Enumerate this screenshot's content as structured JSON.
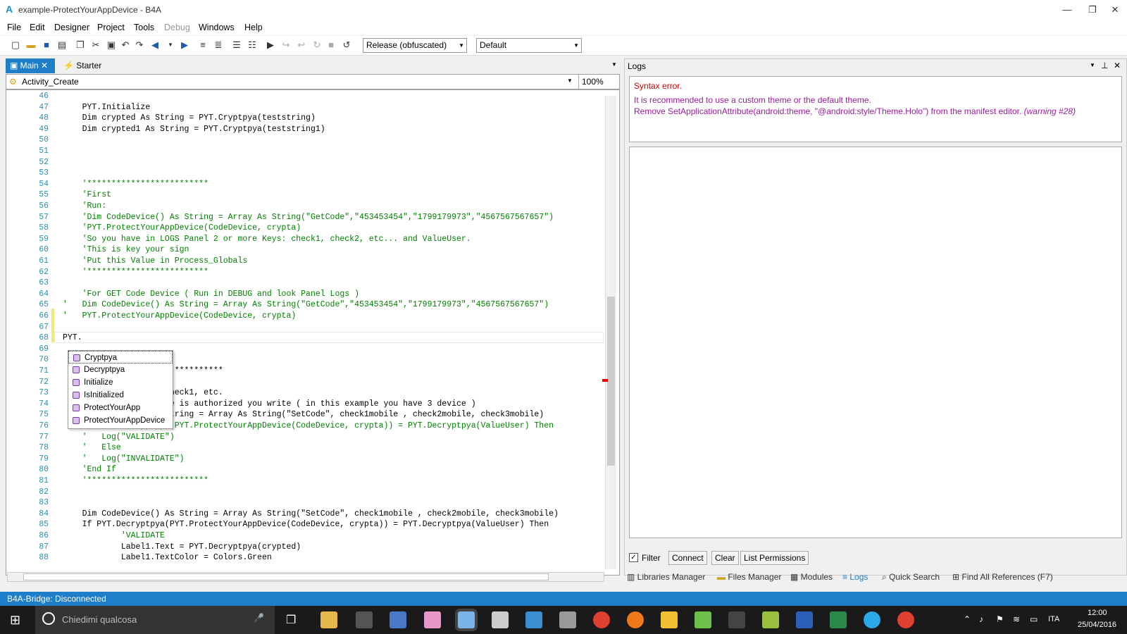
{
  "window": {
    "title": "example-ProtectYourAppDevice - B4A",
    "minimize_glyph": "—",
    "restore_glyph": "❐",
    "close_glyph": "✕"
  },
  "menu": [
    "File",
    "Edit",
    "Designer",
    "Project",
    "Tools",
    "Debug",
    "Windows",
    "Help"
  ],
  "toolbar": {
    "build_config": "Release (obfuscated)",
    "device": "Default"
  },
  "editor": {
    "tabs": [
      {
        "label": "Main",
        "active": true
      },
      {
        "label": "Starter",
        "active": false
      }
    ],
    "sub_selector": "Activity_Create",
    "zoom": "100%",
    "lines": [
      {
        "n": "46",
        "text": ""
      },
      {
        "n": "47",
        "text": "    PYT.Initialize"
      },
      {
        "n": "48",
        "text": "    Dim crypted As String = PYT.Cryptpya(teststring)"
      },
      {
        "n": "49",
        "text": "    Dim crypted1 As String = PYT.Cryptpya(teststring1)"
      },
      {
        "n": "50",
        "text": ""
      },
      {
        "n": "51",
        "text": ""
      },
      {
        "n": "52",
        "text": ""
      },
      {
        "n": "53",
        "text": ""
      },
      {
        "n": "54",
        "text": "    '*************************"
      },
      {
        "n": "55",
        "text": "    'First"
      },
      {
        "n": "56",
        "text": "    'Run:"
      },
      {
        "n": "57",
        "text": "    'Dim CodeDevice() As String = Array As String(\"GetCode\",\"453453454\",\"1799179973\",\"4567567567657\")"
      },
      {
        "n": "58",
        "text": "    'PYT.ProtectYourAppDevice(CodeDevice, crypta)"
      },
      {
        "n": "59",
        "text": "    'So you have in LOGS Panel 2 or more Keys: check1, check2, etc... and ValueUser."
      },
      {
        "n": "60",
        "text": "    'This is key your sign"
      },
      {
        "n": "61",
        "text": "    'Put this Value in Process_Globals"
      },
      {
        "n": "62",
        "text": "    '*************************"
      },
      {
        "n": "63",
        "text": ""
      },
      {
        "n": "64",
        "text": "    'For GET Code Device ( Run in DEBUG and look Panel Logs )"
      },
      {
        "n": "65",
        "text": "'   Dim CodeDevice() As String = Array As String(\"GetCode\",\"453453454\",\"1799179973\",\"4567567567657\")"
      },
      {
        "n": "66",
        "text": "'   PYT.ProtectYourAppDevice(CodeDevice, crypta)"
      },
      {
        "n": "67",
        "text": ""
      },
      {
        "n": "68",
        "text": "PYT."
      },
      {
        "n": "69",
        "text": ""
      },
      {
        "n": "70",
        "text": ""
      },
      {
        "n": "71",
        "text": "                      ***********"
      },
      {
        "n": "72",
        "text": ""
      },
      {
        "n": "73",
        "text": "                  ve check1, etc."
      },
      {
        "n": "74",
        "text": "                  evice is authorized you write ( in this example you have 3 device )"
      },
      {
        "n": "75",
        "text": "                  As String = Array As String(\"SetCode\", check1mobile , check2mobile, check3mobile)"
      },
      {
        "n": "76",
        "text": "    'If PYT.Decryptpya(PYT.ProtectYourAppDevice(CodeDevice, crypta)) = PYT.Decryptpya(ValueUser) Then"
      },
      {
        "n": "77",
        "text": "    '   Log(\"VALIDATE\")"
      },
      {
        "n": "78",
        "text": "    '   Else"
      },
      {
        "n": "79",
        "text": "    '   Log(\"INVALIDATE\")"
      },
      {
        "n": "80",
        "text": "    'End If"
      },
      {
        "n": "81",
        "text": "    '*************************"
      },
      {
        "n": "82",
        "text": ""
      },
      {
        "n": "83",
        "text": ""
      },
      {
        "n": "84",
        "text": "    Dim CodeDevice() As String = Array As String(\"SetCode\", check1mobile , check2mobile, check3mobile)"
      },
      {
        "n": "85",
        "text": "    If PYT.Decryptpya(PYT.ProtectYourAppDevice(CodeDevice, crypta)) = PYT.Decryptpya(ValueUser) Then"
      },
      {
        "n": "86",
        "text": "            'VALIDATE"
      },
      {
        "n": "87",
        "text": "            Label1.Text = PYT.Decryptpya(crypted)"
      },
      {
        "n": "88",
        "text": "            Label1.TextColor = Colors.Green"
      }
    ],
    "autocomplete": [
      "Cryptpya",
      "Decryptpya",
      "Initialize",
      "IsInitialized",
      "ProtectYourApp",
      "ProtectYourAppDevice"
    ]
  },
  "logs": {
    "title": "Logs",
    "error": "Syntax error.",
    "warning_line1": "It is recommended to use a custom theme or the default theme.",
    "warning_line2": "Remove SetApplicationAttribute(android:theme, \"@android:style/Theme.Holo\") from the manifest editor.",
    "warning_tag": "(warning #28)",
    "filter_label": "Filter",
    "connect_label": "Connect",
    "clear_label": "Clear",
    "list_permissions_label": "List Permissions"
  },
  "bottom_tabs": [
    "Libraries Manager",
    "Files Manager",
    "Modules",
    "Logs",
    "Quick Search",
    "Find All References (F7)"
  ],
  "status": "B4A-Bridge: Disconnected",
  "taskbar": {
    "search_placeholder": "Chiedimi qualcosa",
    "lang": "ITA",
    "time": "12:00",
    "date": "25/04/2016"
  },
  "colors": {
    "accent": "#1e7ec8",
    "error_red": "#cc0000",
    "warning_purple": "#9b1a9b"
  }
}
